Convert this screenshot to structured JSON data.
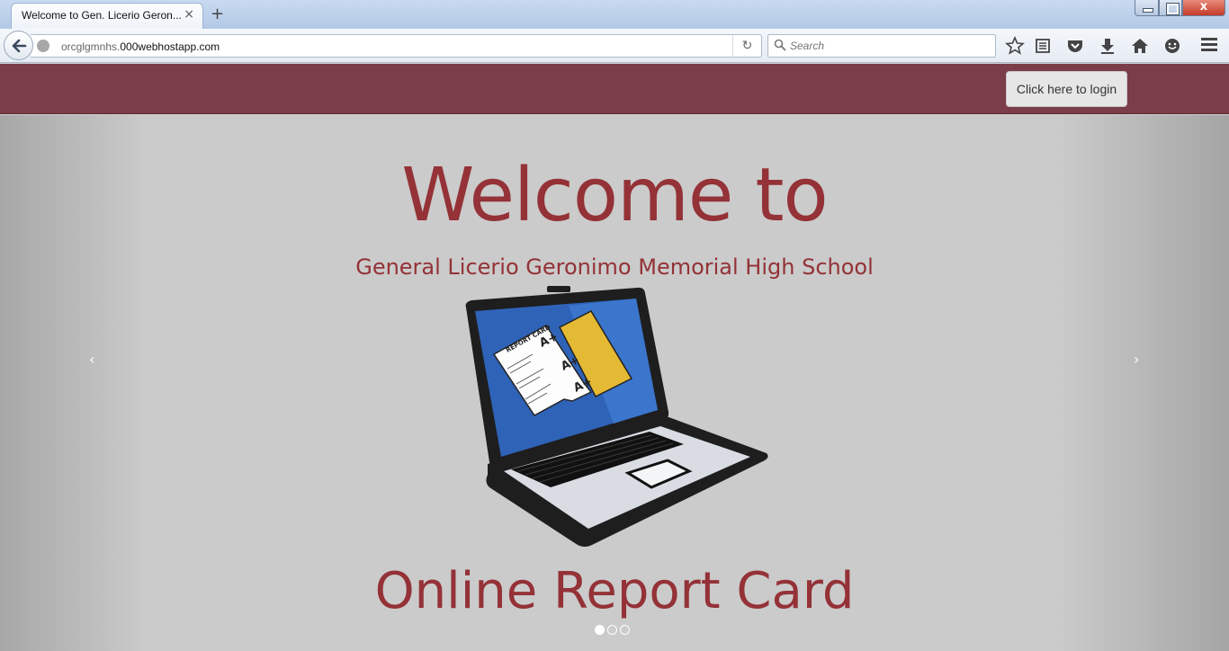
{
  "browser": {
    "tab_title": "Welcome to Gen. Licerio Geron...",
    "tab_close": "×",
    "new_tab": "+",
    "url_prefix": "orcglgmnhs.",
    "url_domain": "000webhostapp.com",
    "search_placeholder": "Search",
    "close_glyph": "x"
  },
  "header": {
    "login_label": "Click here to login",
    "background": "#7b3d48"
  },
  "slide": {
    "title": "Welcome to",
    "subtitle": "General Licerio Geronimo Memorial High School",
    "caption": "Online Report Card",
    "text_color": "#943237",
    "prev_glyph": "‹",
    "next_glyph": "›",
    "active_index": 0,
    "slide_count": 3,
    "image_text": {
      "card_heading": "REPORT CARD",
      "grades": [
        "A+",
        "A+",
        "A+"
      ]
    }
  }
}
